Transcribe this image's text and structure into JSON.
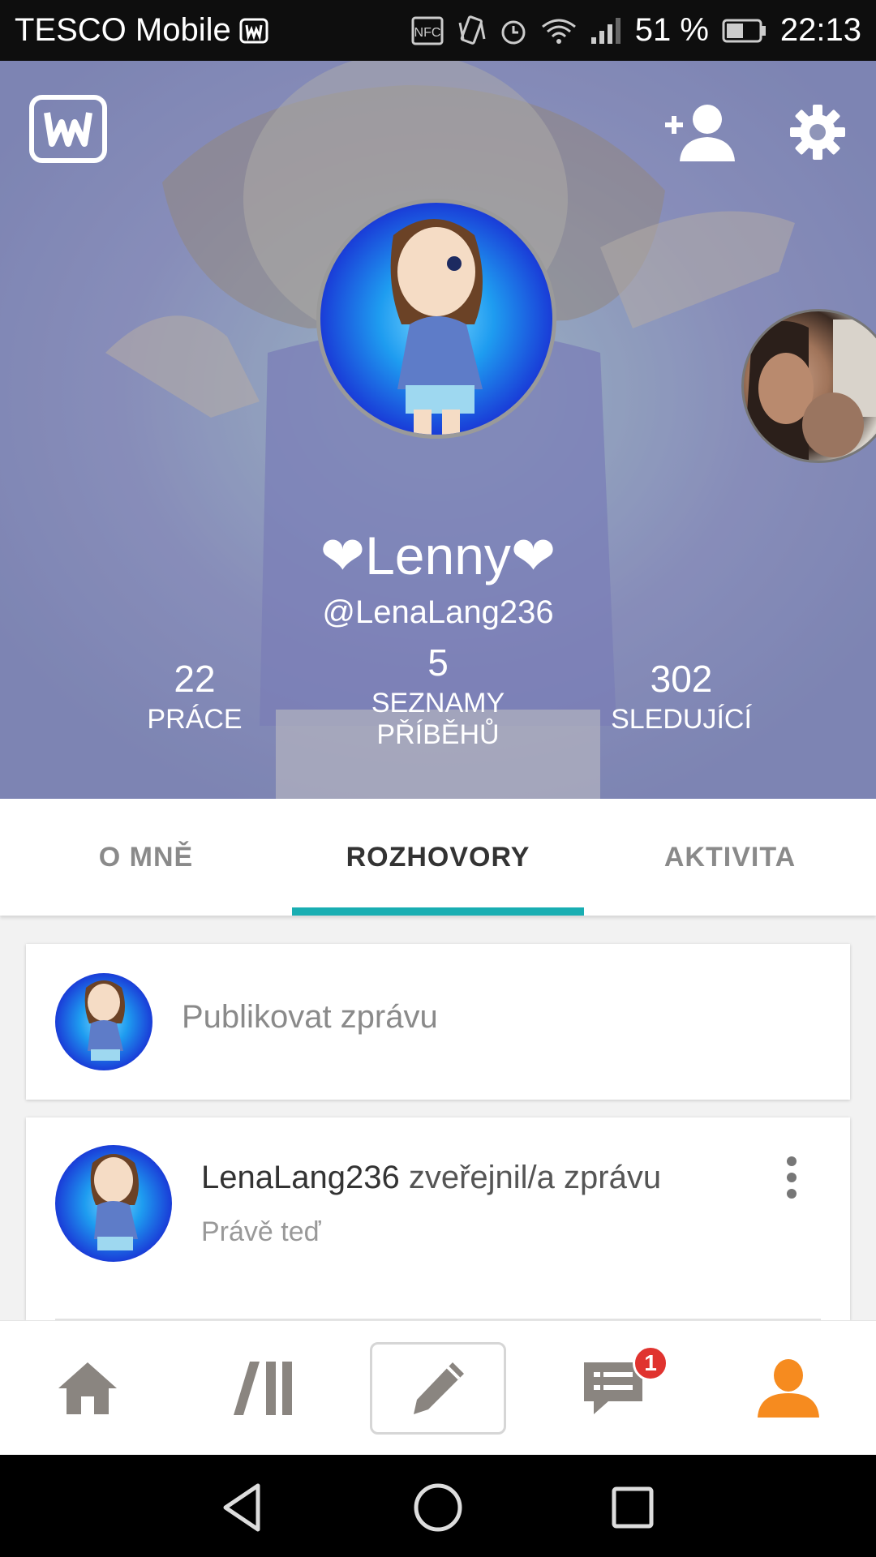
{
  "status_bar": {
    "carrier": "TESCO Mobile",
    "battery_percent": "51 %",
    "time": "22:13",
    "icons": [
      "wattpad-notification-icon",
      "nfc-icon",
      "vibrate-icon",
      "alarm-icon",
      "wifi-icon",
      "signal-icon",
      "battery-icon"
    ]
  },
  "header": {
    "display_name": "❤Lenny❤",
    "username": "@LenaLang236",
    "stats": [
      {
        "value": "22",
        "label": "PRÁCE"
      },
      {
        "value": "5",
        "label": "SEZNAMY PŘÍBĚHŮ"
      },
      {
        "value": "302",
        "label": "SLEDUJÍCÍ"
      }
    ]
  },
  "tabs": [
    {
      "label": "O MNĚ",
      "active": false
    },
    {
      "label": "ROZHOVORY",
      "active": true
    },
    {
      "label": "AKTIVITA",
      "active": false
    }
  ],
  "compose": {
    "placeholder": "Publikovat zprávu"
  },
  "post": {
    "username": "LenaLang236",
    "action": " zveřejnil/a zprávu",
    "time": "Právě teď"
  },
  "bottom_nav": {
    "items": [
      "home-icon",
      "library-icon",
      "write-icon",
      "messages-icon",
      "profile-icon"
    ],
    "messages_badge": "1",
    "active_color": "#f68b1f"
  },
  "colors": {
    "accent": "#19aeb2",
    "badge": "#e0332f"
  }
}
